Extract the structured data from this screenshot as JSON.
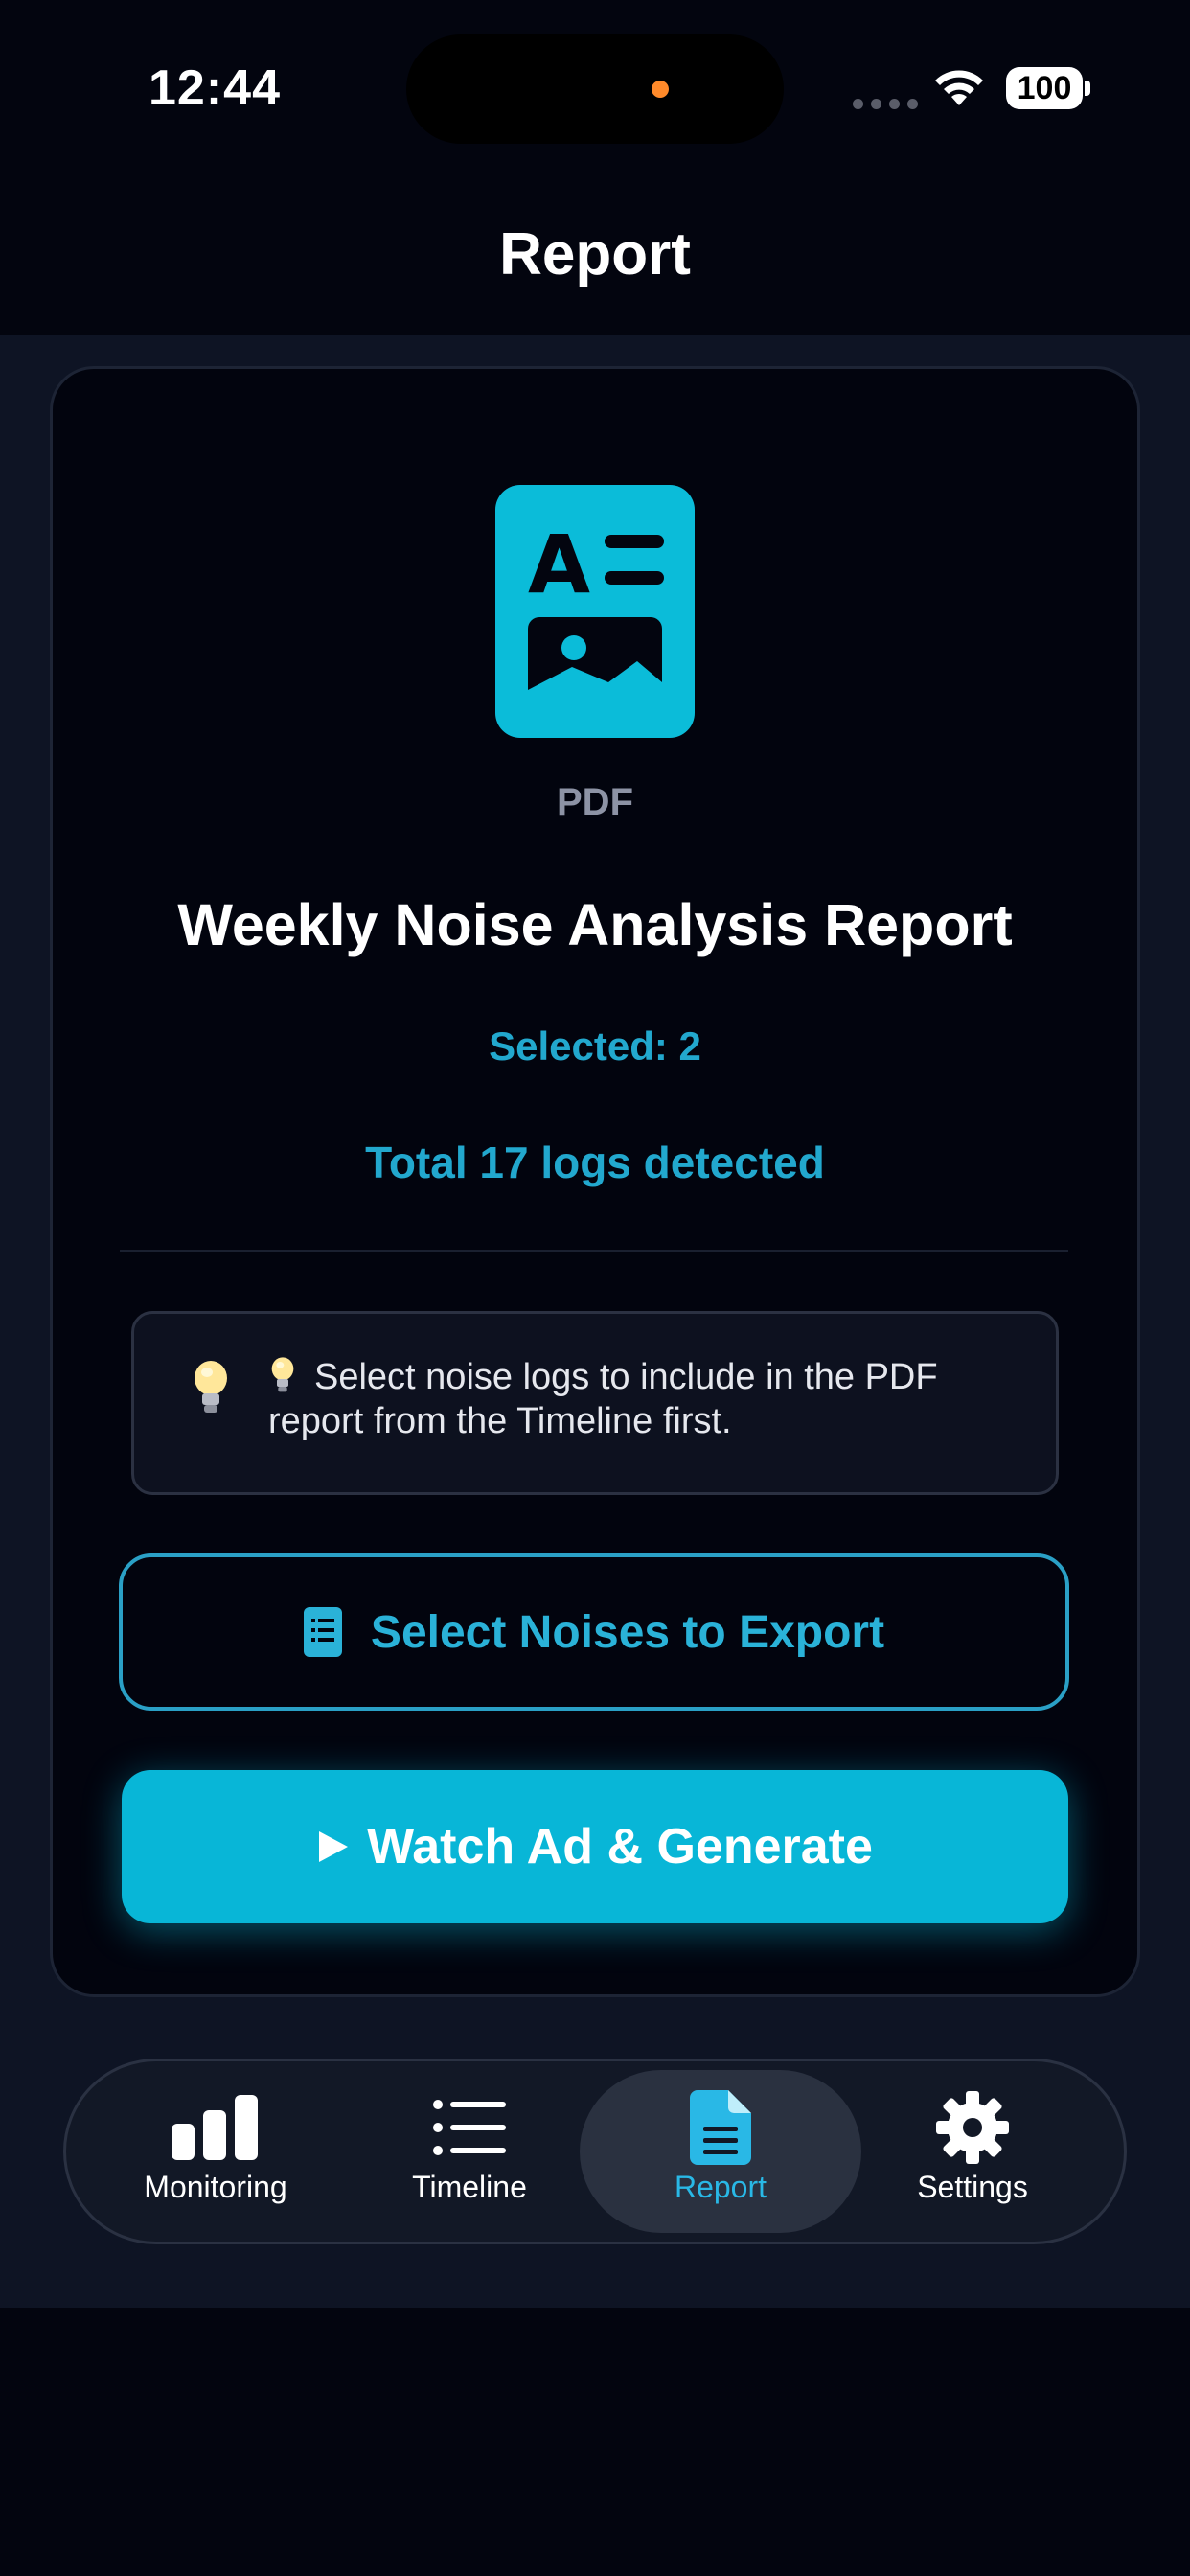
{
  "status_bar": {
    "time": "12:44",
    "battery": "100"
  },
  "header": {
    "title": "Report"
  },
  "report": {
    "file_type": "PDF",
    "title": "Weekly Noise Analysis Report",
    "selected": "Selected: 2",
    "total": "Total 17 logs detected",
    "tip": "💡 Select noise logs to include in the PDF report from the Timeline first.",
    "tip_text": "Select noise logs to include in the PDF report from the Timeline first.",
    "select_button": "Select Noises to Export",
    "generate_button": "Watch Ad & Generate"
  },
  "tabs": [
    {
      "label": "Monitoring",
      "icon": "bar-chart-icon",
      "active": false
    },
    {
      "label": "Timeline",
      "icon": "list-icon",
      "active": false
    },
    {
      "label": "Report",
      "icon": "document-icon",
      "active": true
    },
    {
      "label": "Settings",
      "icon": "gear-icon",
      "active": false
    }
  ],
  "colors": {
    "accent": "#08b6d7",
    "accent_text": "#22a8ce",
    "background": "#03050f",
    "card": "#02040e"
  }
}
